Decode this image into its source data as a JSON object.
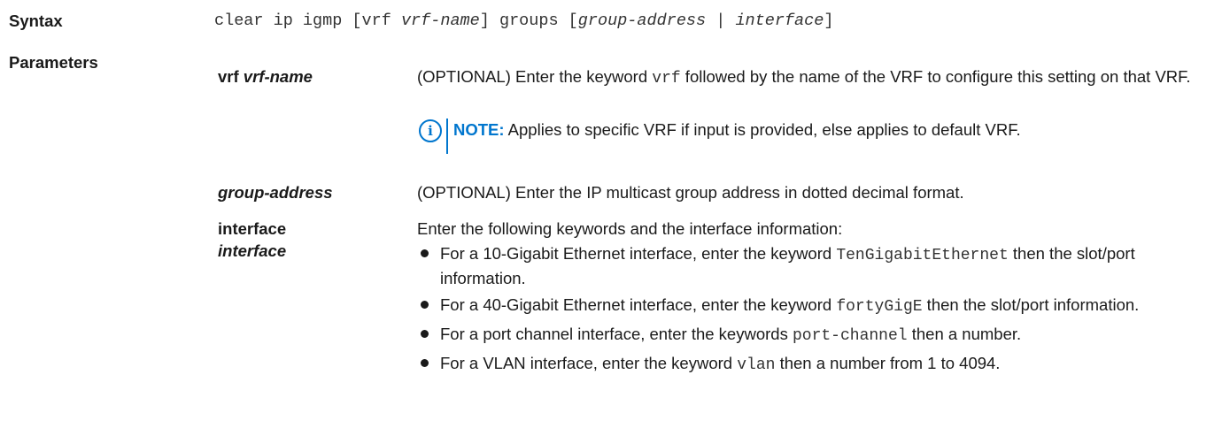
{
  "syntax": {
    "label": "Syntax",
    "cmd1": "clear ip igmp [vrf ",
    "var1": "vrf-name",
    "cmd2": "] groups [",
    "var2": "group-address",
    "cmd3": " | ",
    "var3": "interface",
    "cmd4": "]"
  },
  "parameters": {
    "label": "Parameters",
    "vrf": {
      "kw": "vrf",
      "arg": "vrf-name",
      "desc_a": "(OPTIONAL) Enter the keyword ",
      "desc_code": "vrf",
      "desc_b": " followed by the name of the VRF to configure this setting on that VRF."
    },
    "note": {
      "icon": "info-icon",
      "label": "NOTE:",
      "text": " Applies to specific VRF if input is provided, else applies to default VRF."
    },
    "group": {
      "arg": "group-address",
      "desc": "(OPTIONAL) Enter the IP multicast group address in dotted decimal format."
    },
    "interface": {
      "kw": "interface",
      "arg": "interface",
      "intro": "Enter the following keywords and the interface information:",
      "bullets": [
        {
          "a": "For a 10-Gigabit Ethernet interface, enter the keyword ",
          "code": "TenGigabitEthernet",
          "b": " then the slot/port information."
        },
        {
          "a": "For a 40-Gigabit Ethernet interface, enter the keyword ",
          "code": "fortyGigE",
          "b": " then the slot/port information."
        },
        {
          "a": "For a port channel interface, enter the keywords ",
          "code": "port-channel",
          "b": " then a number."
        },
        {
          "a": "For a VLAN interface, enter the keyword ",
          "code": "vlan",
          "b": " then a number from 1 to 4094."
        }
      ]
    }
  }
}
